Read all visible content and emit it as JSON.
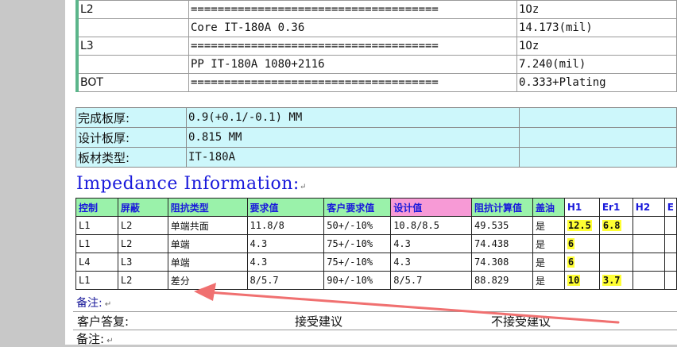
{
  "stackup": [
    {
      "layer": "L2",
      "material": "=====================================",
      "value": "1Oz"
    },
    {
      "layer": "",
      "material": "Core     IT-180A    0.36",
      "value": "14.173(mil)"
    },
    {
      "layer": "L3",
      "material": "=====================================",
      "value": "1Oz"
    },
    {
      "layer": "",
      "material": "PP    IT-180A    1080+2116",
      "value": "7.240(mil)"
    },
    {
      "layer": "BOT",
      "material": "=====================================",
      "value": "0.333+Plating"
    }
  ],
  "board_info": [
    {
      "label": "完成板厚:",
      "value": "0.9(+0.1/-0.1) MM"
    },
    {
      "label": "设计板厚:",
      "value": "0.815 MM"
    },
    {
      "label": "板材类型:",
      "value": "IT-180A"
    }
  ],
  "impedance": {
    "title": "Impedance Information:",
    "headers": [
      "控制",
      "屏蔽",
      "阻抗类型",
      "要求值",
      "客户要求值",
      "设计值",
      "阻抗计算值",
      "盖油",
      "H1",
      "Er1",
      "H2",
      "E"
    ],
    "rows": [
      [
        "L1",
        "L2",
        "单端共面",
        "11.8/8",
        "50+/-10%",
        "10.8/8.5",
        "49.535",
        "是",
        "12.5",
        "6.8",
        "",
        ""
      ],
      [
        "L1",
        "L2",
        "单端",
        "4.3",
        "75+/-10%",
        "4.3",
        "74.438",
        "是",
        "6",
        "",
        "",
        ""
      ],
      [
        "L4",
        "L3",
        "单端",
        "4.3",
        "75+/-10%",
        "4.3",
        "74.308",
        "是",
        "6",
        "",
        "",
        ""
      ],
      [
        "L1",
        "L2",
        "差分",
        "8/5.7",
        "90+/-10%",
        "8/5.7",
        "88.829",
        "是",
        "10",
        "3.7",
        "",
        ""
      ]
    ]
  },
  "remarks1": "备注:",
  "customer_reply": {
    "label": "客户答复:",
    "accept": "接受建议",
    "reject": "不接受建议"
  },
  "remarks2": "备注:",
  "colors": {
    "header_green": "#9af2aa",
    "header_pink": "#f79ad6",
    "info_cyan": "#cdf7fb",
    "highlight": "#ffff33",
    "title_blue": "#1a1adb",
    "arrow": "#f07070"
  }
}
